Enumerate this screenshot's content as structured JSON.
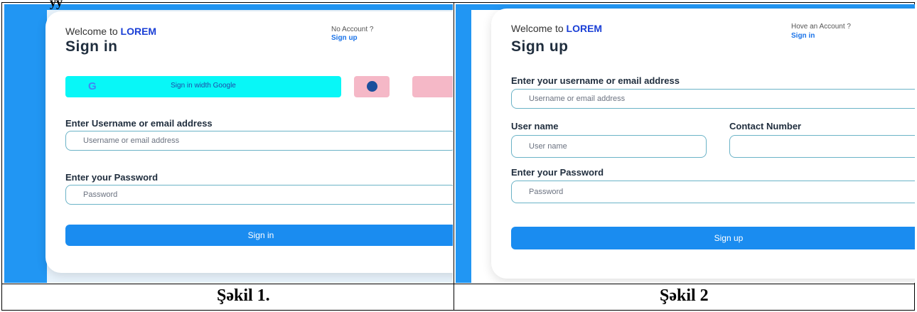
{
  "doc": {
    "top_overflow_text": "yy",
    "captions": [
      "Şəkil 1.",
      "Şəkil 2"
    ]
  },
  "signin": {
    "welcome_prefix": "Welcome to ",
    "brand": "LOREM",
    "title": "Sign in",
    "account_prompt": "No Account ?",
    "account_link": "Sign up",
    "google_label": "Sign in width Google",
    "username_label": "Enter Username or email address",
    "username_placeholder": "Username or email address",
    "password_label": "Enter your Password",
    "password_placeholder": "Password",
    "submit_label": "Sign in"
  },
  "signup": {
    "welcome_prefix": "Welcome to ",
    "brand": "LOREM",
    "title": "Sign up",
    "account_prompt": "Hove an Account ?",
    "account_link": "Sign in",
    "email_label": "Enter your username or email address",
    "email_placeholder": "Username or email address",
    "username_label": "User name",
    "username_placeholder": "User name",
    "contact_label": "Contact Number",
    "contact_placeholder": "",
    "password_label": "Enter your Password",
    "password_placeholder": "Password",
    "submit_label": "Sign up"
  },
  "colors": {
    "brand": "#1a3fd6",
    "primary": "#1a8cf0",
    "google_button": "#08f7f7",
    "social_button": "#f5b8c7"
  },
  "icons": [
    "google-icon",
    "facebook-icon",
    "apple-icon"
  ]
}
